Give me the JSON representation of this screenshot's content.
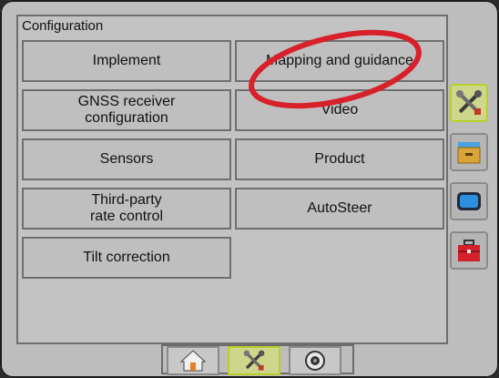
{
  "panel": {
    "title": "Configuration"
  },
  "buttons": {
    "implement": "Implement",
    "mapping": "Mapping and guidance",
    "gnss": "GNSS receiver\nconfiguration",
    "video": "Video",
    "sensors": "Sensors",
    "product": "Product",
    "third_party": "Third-party\nrate control",
    "autosteer": "AutoSteer",
    "tilt": "Tilt correction"
  },
  "sidebar": {
    "items": [
      {
        "icon": "tools-icon",
        "active": true
      },
      {
        "icon": "file-drawer-icon",
        "active": false
      },
      {
        "icon": "display-icon",
        "active": false
      },
      {
        "icon": "toolbox-icon",
        "active": false
      }
    ]
  },
  "bottom_tabs": [
    {
      "icon": "home-icon",
      "active": false
    },
    {
      "icon": "tools-icon",
      "active": true
    },
    {
      "icon": "camera-icon",
      "active": false
    }
  ],
  "colors": {
    "accent_active": "#b8cf2a",
    "annotation_red": "#d8202a"
  }
}
